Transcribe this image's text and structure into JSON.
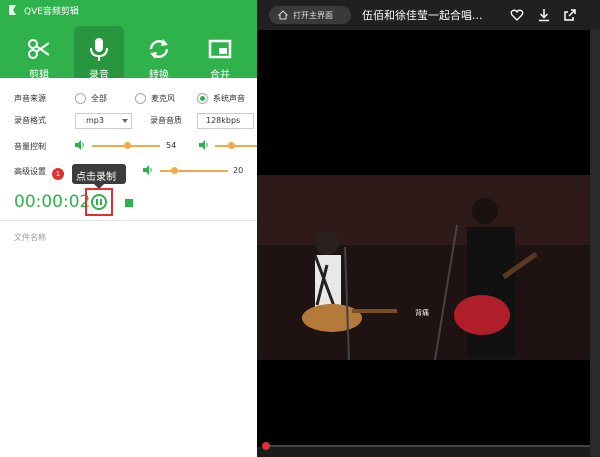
{
  "app": {
    "title": "QVE音频剪辑",
    "tools": [
      {
        "label": "剪辑",
        "icon": "scissors-icon"
      },
      {
        "label": "录音",
        "icon": "microphone-icon"
      },
      {
        "label": "转换",
        "icon": "convert-icon"
      },
      {
        "label": "合并",
        "icon": "merge-icon"
      }
    ],
    "active_tool": 1,
    "colors": {
      "brand": "#2fb24c",
      "accent": "#f2a94a",
      "alert": "#e03030"
    }
  },
  "source": {
    "label": "声音来源",
    "options": [
      "全部",
      "麦克风",
      "系统声音"
    ],
    "selected": 2
  },
  "format": {
    "label": "录音格式",
    "value": "mp3",
    "quality_label": "录音音质",
    "quality_value": "128kbps"
  },
  "volume": {
    "label": "音量控制",
    "value1": "54",
    "value1_fraction": 0.54,
    "value2_fraction": 0.4
  },
  "advanced": {
    "label": "高级设置",
    "volume_value": "20",
    "volume_fraction": 0.2
  },
  "recording": {
    "time": "00:00:02",
    "badge": "1",
    "tooltip": "点击录制"
  },
  "file": {
    "label": "文件名称"
  },
  "player": {
    "home_label": "打开主界面",
    "title": "伍佰和徐佳莹一起合唱...",
    "subtitle": "背痛",
    "progress_fraction": 0.0
  }
}
